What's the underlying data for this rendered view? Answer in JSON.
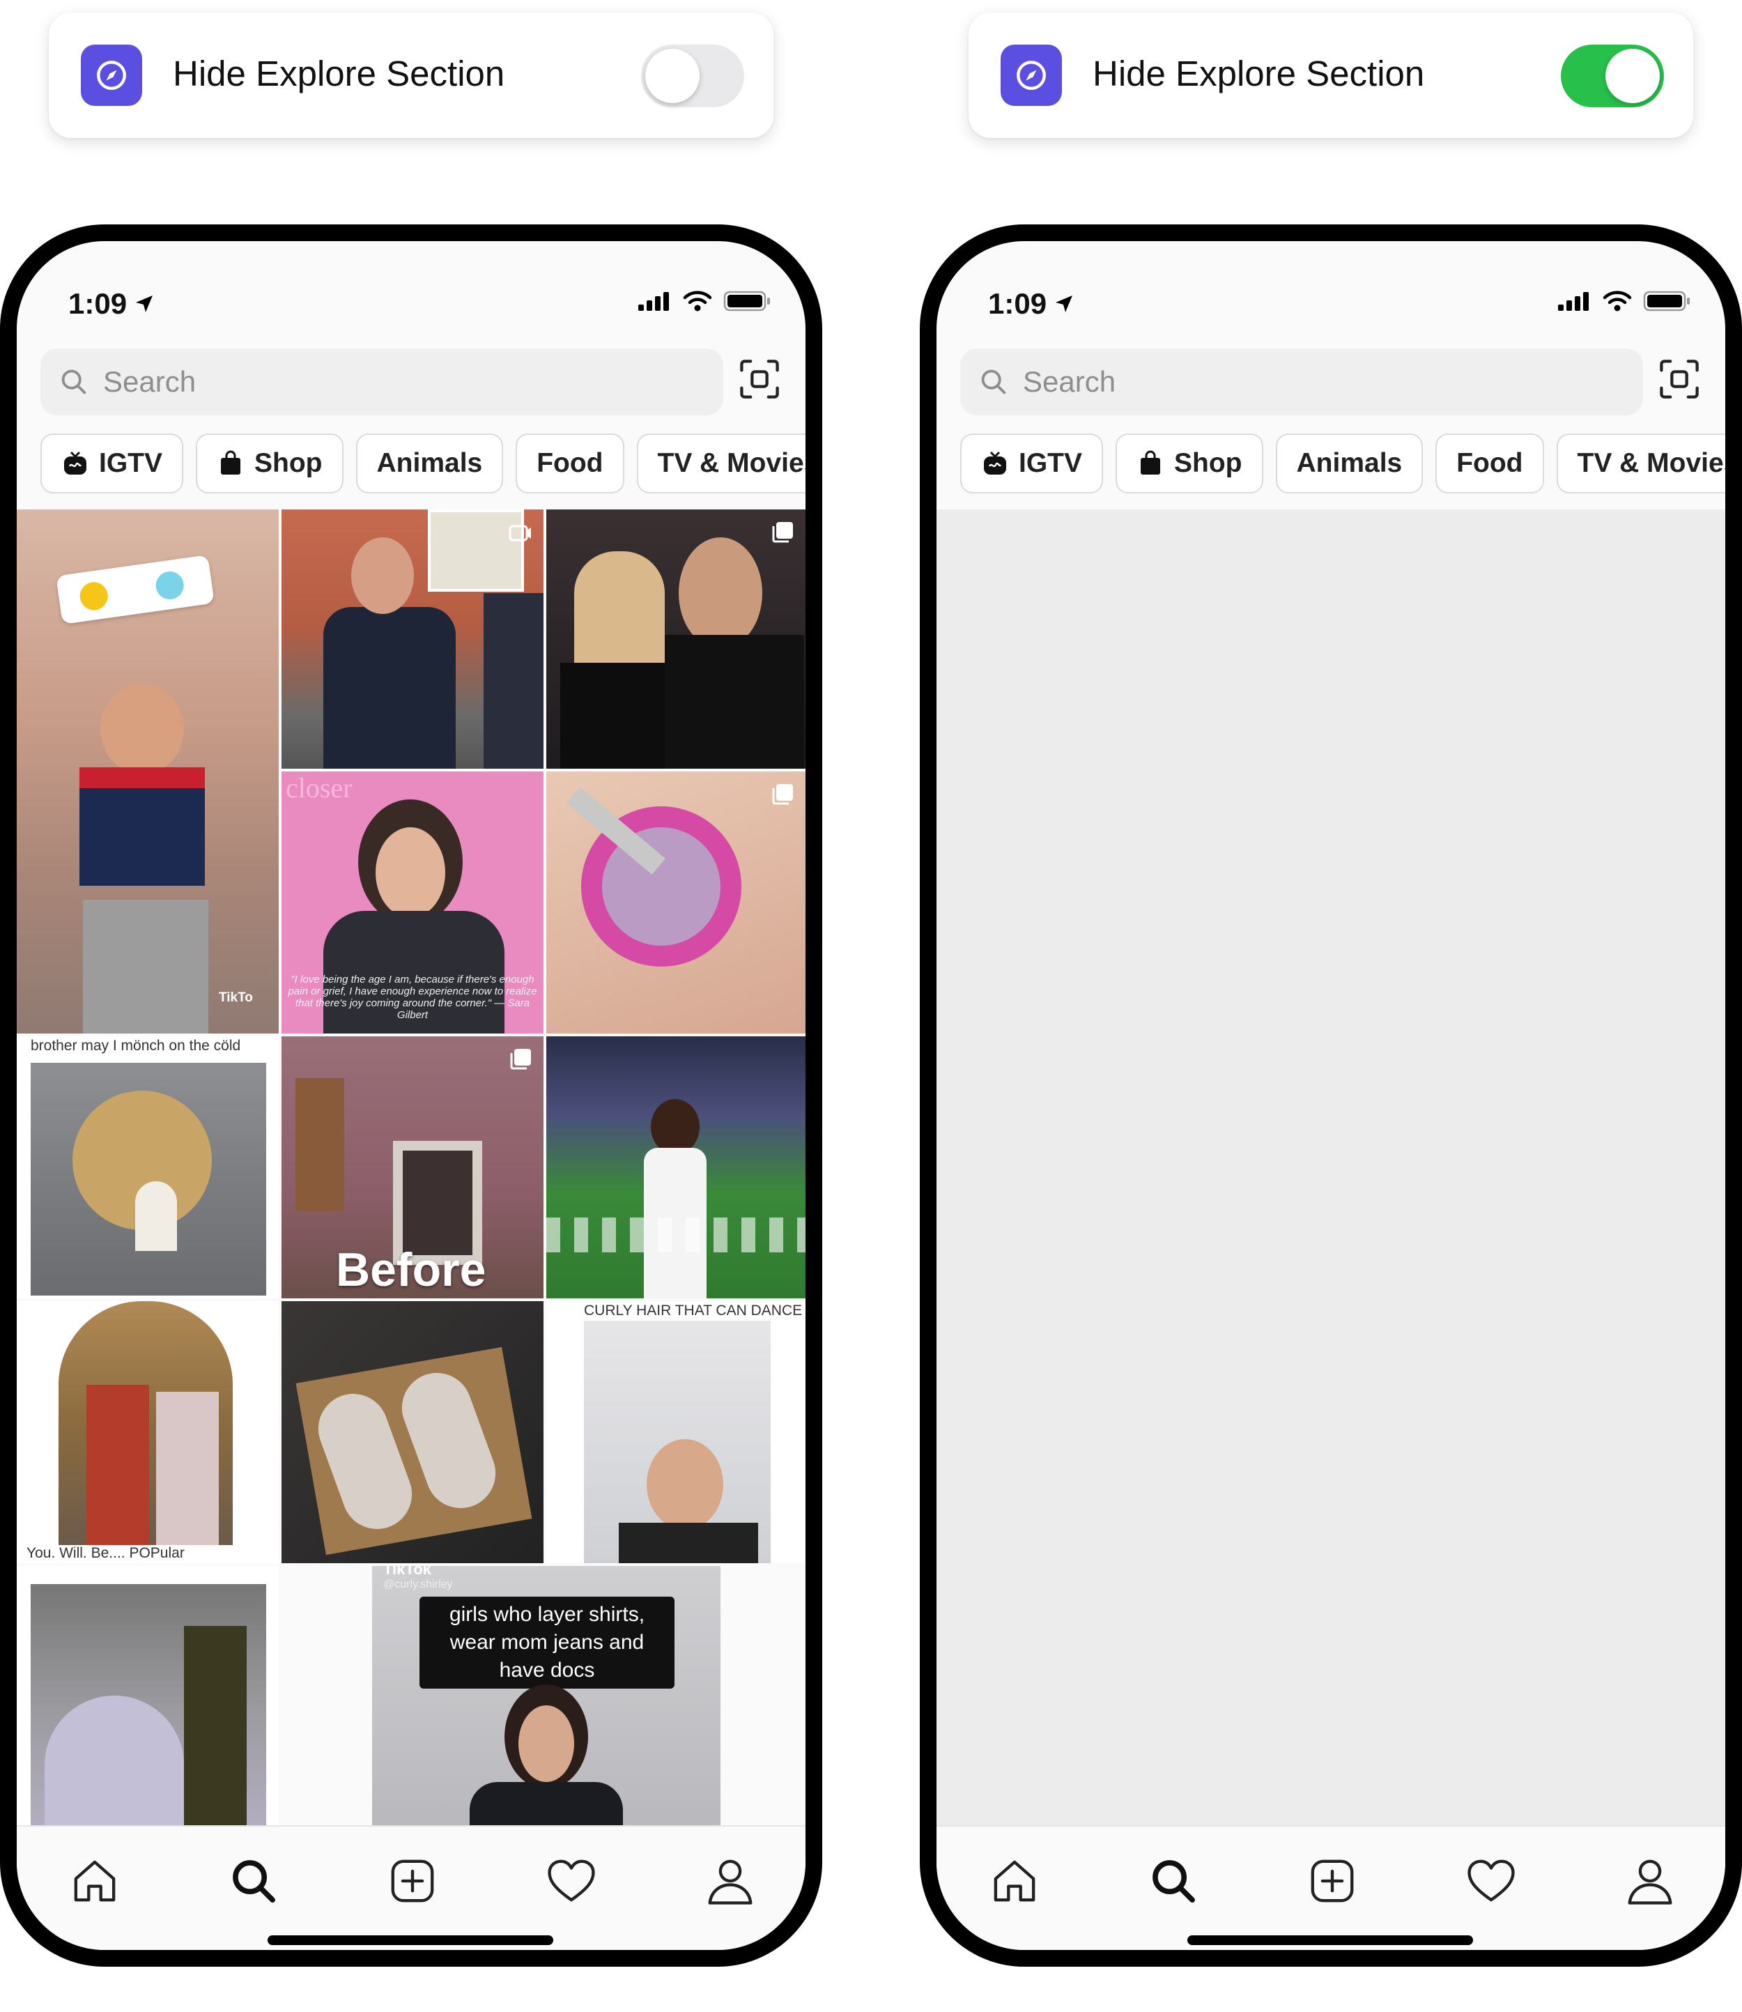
{
  "left": {
    "card": {
      "label": "Hide Explore Section",
      "toggle_on": false
    },
    "phone": {
      "status": {
        "time": "1:09"
      },
      "search": {
        "placeholder": "Search"
      },
      "chips": [
        {
          "label": "IGTV",
          "icon": "igtv-icon"
        },
        {
          "label": "Shop",
          "icon": "shopping-bag-icon"
        },
        {
          "label": "Animals"
        },
        {
          "label": "Food"
        },
        {
          "label": "TV & Movies"
        }
      ],
      "captions": {
        "dog": "brother may I mönch on the cöld",
        "tiktok1": "TikTo",
        "quote": "\"I love being the age I am, because if there's enough pain or grief, I have enough experience now to realize that there's joy coming around the corner.\" — Sara Gilbert",
        "closer": "closer",
        "before": "Before",
        "curly": "CURLY HAIR THAT CAN DANCE",
        "popular": "You. Will. Be.... POPular",
        "tiktok2": "TikTok",
        "tiktok2_user": "@curly.shirley",
        "girls": "girls who layer shirts, wear mom jeans and have docs"
      }
    }
  },
  "right": {
    "card": {
      "label": "Hide Explore Section",
      "toggle_on": true
    },
    "phone": {
      "status": {
        "time": "1:09"
      },
      "search": {
        "placeholder": "Search"
      },
      "chips": [
        {
          "label": "IGTV",
          "icon": "igtv-icon"
        },
        {
          "label": "Shop",
          "icon": "shopping-bag-icon"
        },
        {
          "label": "Animals"
        },
        {
          "label": "Food"
        },
        {
          "label": "TV & Movies"
        }
      ]
    }
  },
  "nav": [
    "home-icon",
    "search-icon",
    "new-post-icon",
    "heart-icon",
    "profile-icon"
  ],
  "colors": {
    "toggle_on": "#27c04b",
    "toggle_off": "#e9e9eb",
    "app_icon": "#5a4fe0"
  }
}
